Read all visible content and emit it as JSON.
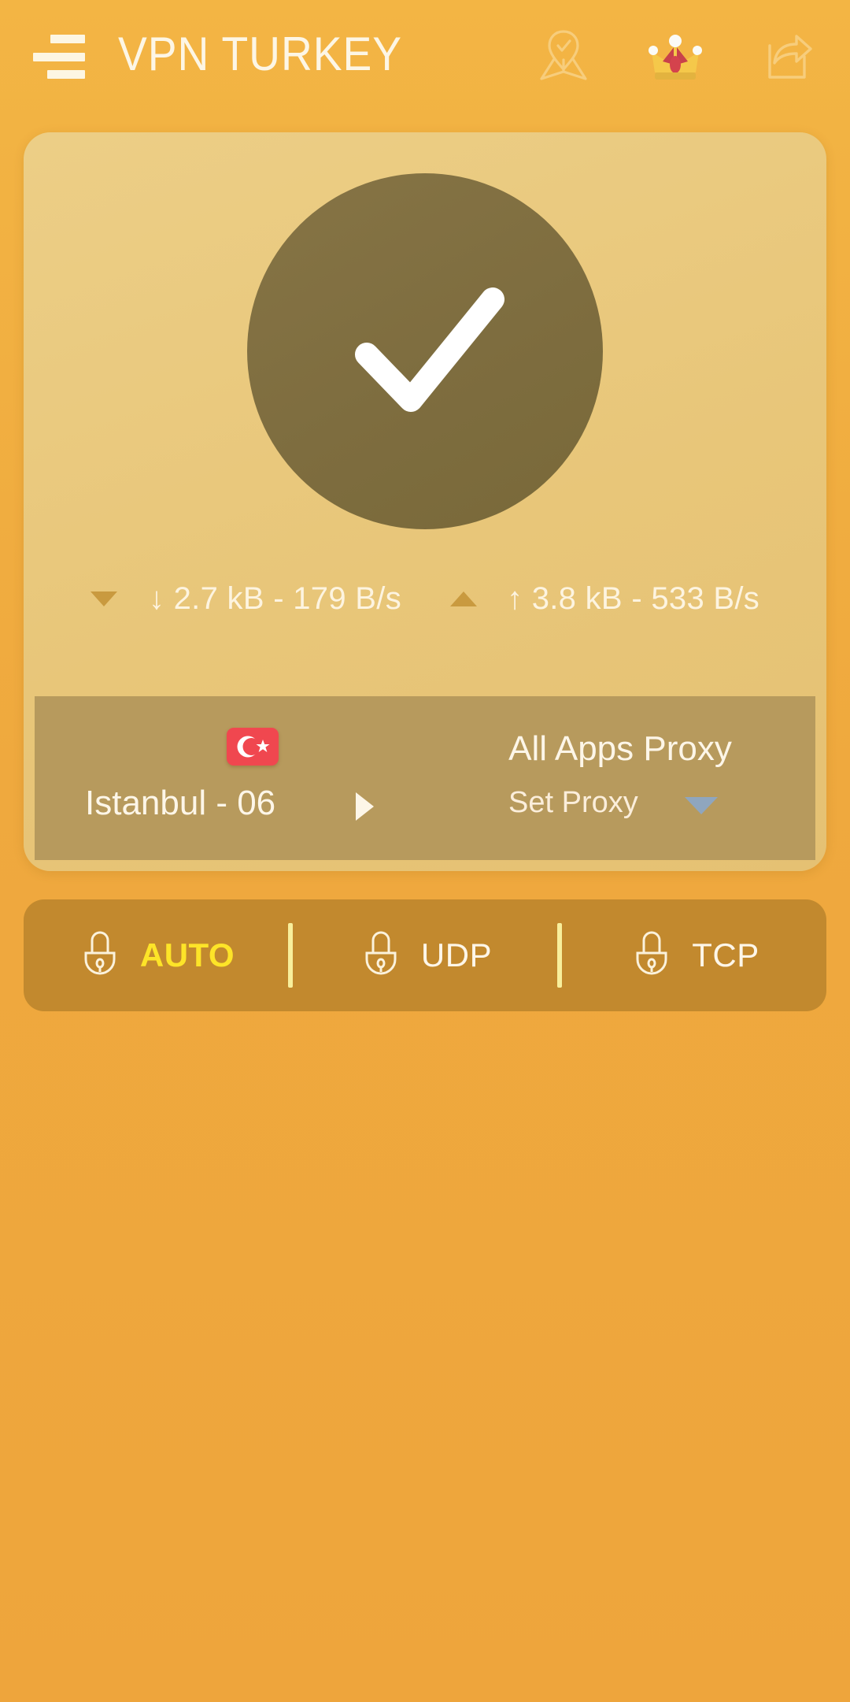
{
  "app": {
    "title": "VPN TURKEY",
    "background_color": "#efa93e",
    "accent_yellow": "#fde428",
    "card_color": "#e8c679",
    "panel_color": "#b79a5d",
    "protocol_bar_color": "#c2892e",
    "circle_color": "#7e6d3f"
  },
  "topbar": {
    "menu_icon": "hamburger-menu-icon",
    "title": "VPN TURKEY",
    "icons": [
      {
        "name": "map-location-icon",
        "label": "Locations"
      },
      {
        "name": "crown-premium-icon",
        "label": "Premium"
      },
      {
        "name": "share-icon",
        "label": "Share"
      }
    ]
  },
  "status_card": {
    "connection_icon": "checkmark-icon",
    "connection_state": "connected",
    "download": {
      "arrow": "↓",
      "text": "↓ 2.7 kB - 179 B/s",
      "total": "2.7 kB",
      "rate": "179 B/s",
      "triangle": "triangle-down-icon"
    },
    "upload": {
      "arrow": "↑",
      "text": "↑ 3.8 kB - 533 B/s",
      "total": "3.8 kB",
      "rate": "533 B/s",
      "triangle": "triangle-up-icon"
    }
  },
  "location": {
    "flag": "turkey-flag-icon",
    "name": "Istanbul - 06",
    "chevron": "chevron-right-icon"
  },
  "proxy": {
    "title": "All Apps Proxy",
    "subtitle": "Set Proxy",
    "caret": "caret-down-icon",
    "caret_color": "#8fa6be"
  },
  "protocols": {
    "selected": "AUTO",
    "options": [
      {
        "label": "AUTO",
        "icon": "lock-icon",
        "active": true
      },
      {
        "label": "UDP",
        "icon": "lock-icon",
        "active": false
      },
      {
        "label": "TCP",
        "icon": "lock-icon",
        "active": false
      }
    ]
  }
}
